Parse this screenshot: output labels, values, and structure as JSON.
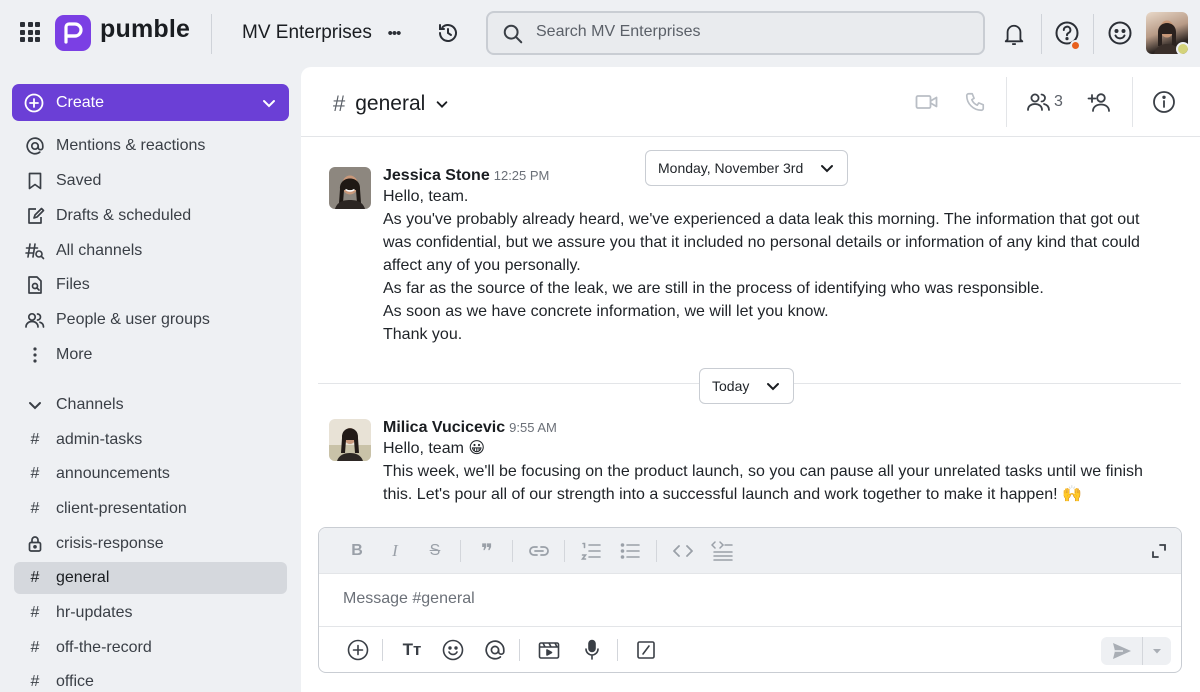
{
  "app": {
    "name": "pumble",
    "brand_color": "#7b3fe4"
  },
  "topbar": {
    "workspace": "MV Enterprises",
    "more_glyph": "•••",
    "search_placeholder": "Search MV Enterprises",
    "help_notification_color": "#e8611e"
  },
  "sidebar": {
    "create_label": "Create",
    "items": [
      {
        "label": "Mentions & reactions",
        "icon": "at-icon"
      },
      {
        "label": "Saved",
        "icon": "bookmark-icon"
      },
      {
        "label": "Drafts & scheduled",
        "icon": "draft-icon"
      },
      {
        "label": "All channels",
        "icon": "channels-search-icon"
      },
      {
        "label": "Files",
        "icon": "files-icon"
      },
      {
        "label": "People & user groups",
        "icon": "people-icon"
      },
      {
        "label": "More",
        "icon": "more-vertical-icon"
      }
    ],
    "channels_header": "Channels",
    "channels": [
      {
        "name": "admin-tasks",
        "icon": "hash"
      },
      {
        "name": "announcements",
        "icon": "hash"
      },
      {
        "name": "client-presentation",
        "icon": "hash"
      },
      {
        "name": "crisis-response",
        "icon": "lock"
      },
      {
        "name": "general",
        "icon": "hash",
        "active": true
      },
      {
        "name": "hr-updates",
        "icon": "hash"
      },
      {
        "name": "off-the-record",
        "icon": "hash"
      },
      {
        "name": "office",
        "icon": "hash"
      }
    ]
  },
  "channel": {
    "hash": "#",
    "name": "general",
    "member_count": "3"
  },
  "messages": {
    "date1": "Monday, November 3rd",
    "date2": "Today",
    "m1": {
      "author": "Jessica Stone",
      "time": "12:25 PM",
      "lines": [
        "Hello, team.",
        "As you've probably already heard, we've experienced a data leak this morning. The information that got out",
        "was confidential, but we assure you that it included no personal details or information of any kind that could",
        "affect any of you personally.",
        "As far as the source of the leak, we are still in the process of identifying who was responsible.",
        "As soon as we have concrete information, we will let you know.",
        "Thank you."
      ]
    },
    "m2": {
      "author": "Milica Vucicevic",
      "time": "9:55 AM",
      "lines": [
        "Hello, team 😀",
        "This week, we'll be focusing on the product launch, so you can pause all your unrelated tasks until we finish",
        "this. Let's pour all of our strength into a successful launch and work together to make it happen! 🙌"
      ]
    }
  },
  "composer": {
    "placeholder": "Message #general"
  }
}
